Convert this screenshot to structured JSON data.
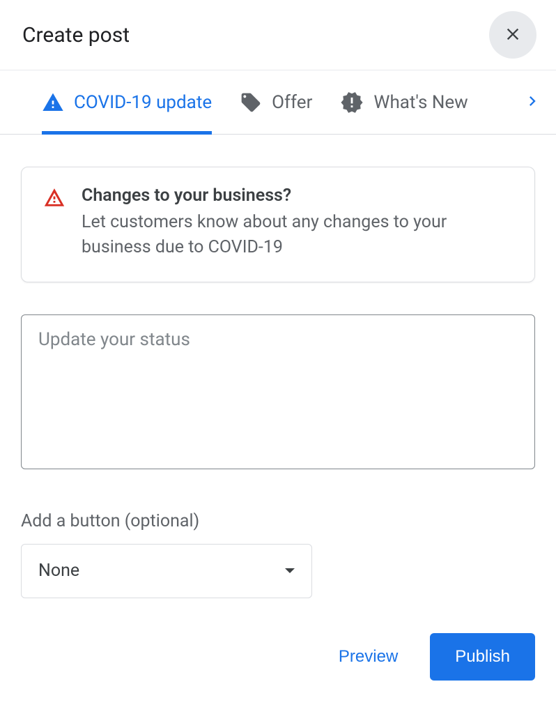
{
  "header": {
    "title": "Create post"
  },
  "tabs": [
    {
      "label": "COVID-19 update",
      "active": true
    },
    {
      "label": "Offer",
      "active": false
    },
    {
      "label": "What's New",
      "active": false
    }
  ],
  "info": {
    "title": "Changes to your business?",
    "desc": "Let customers know about any changes to your business due to COVID-19"
  },
  "status": {
    "placeholder": "Update your status",
    "value": ""
  },
  "addButton": {
    "label": "Add a button (optional)",
    "selected": "None"
  },
  "actions": {
    "preview": "Preview",
    "publish": "Publish"
  },
  "colors": {
    "primary": "#1a73e8",
    "warning": "#d93025",
    "muted": "#5f6368"
  }
}
